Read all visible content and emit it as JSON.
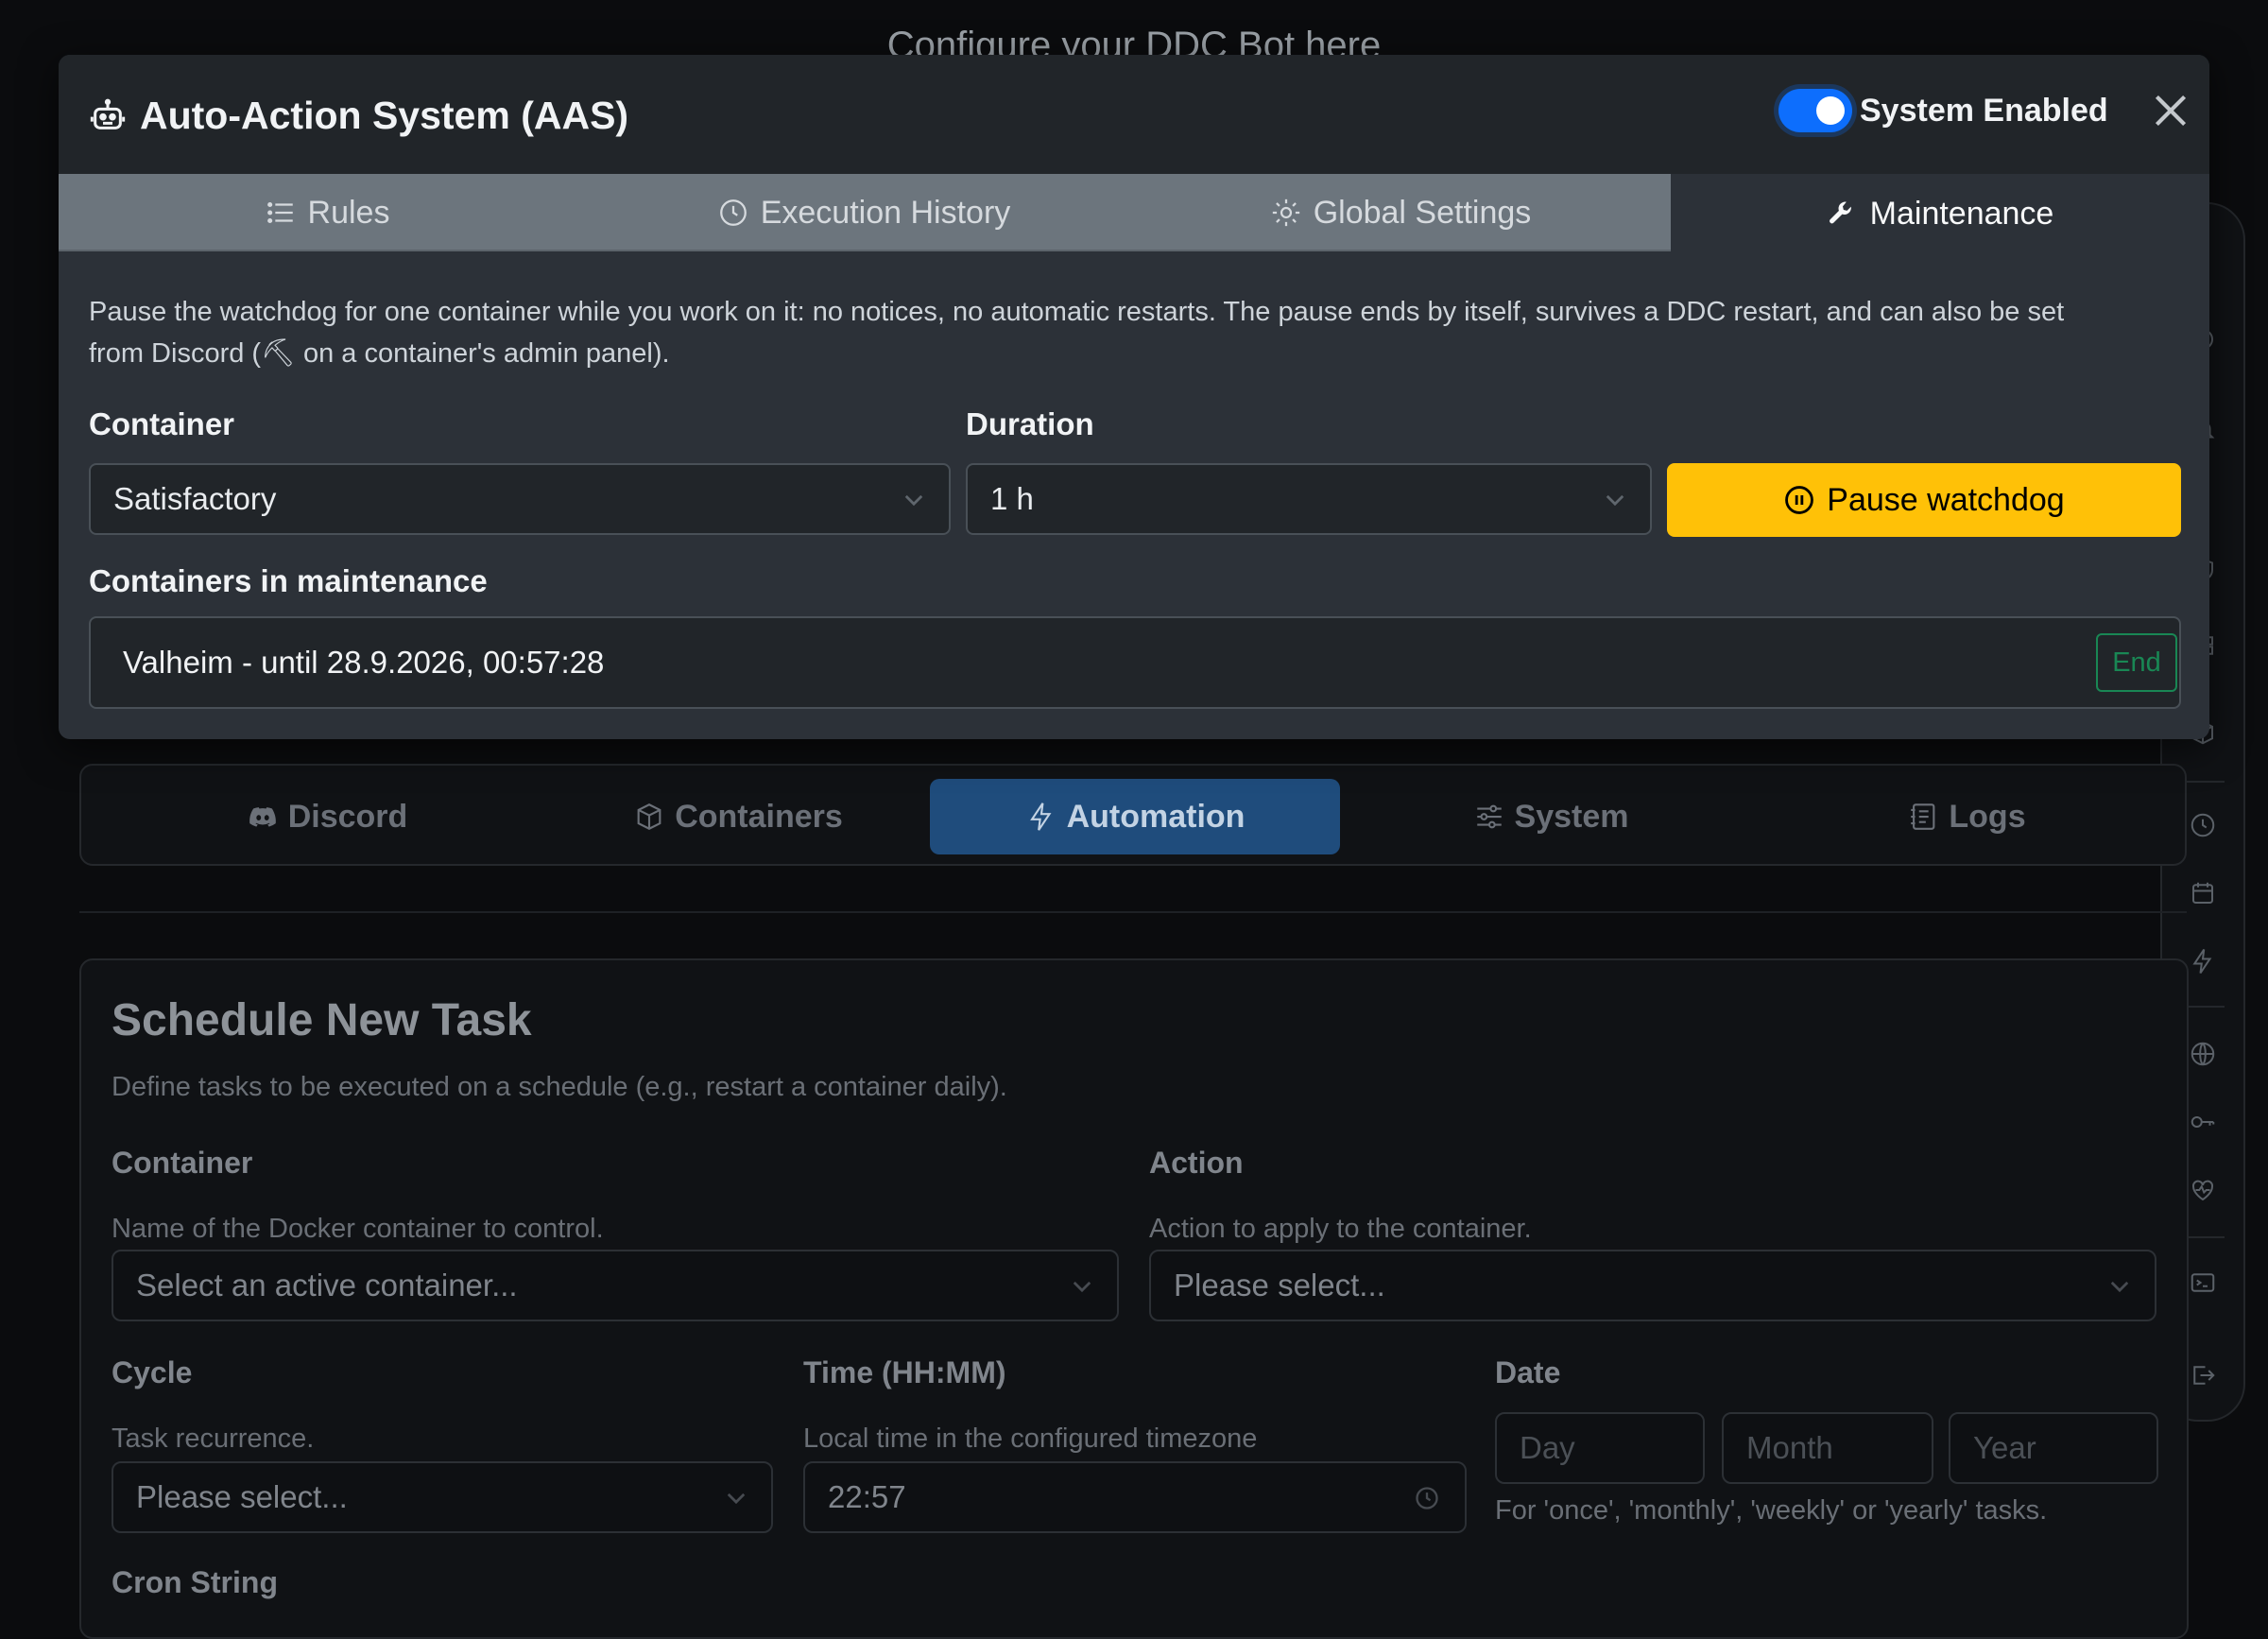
{
  "background": {
    "header_text": "Configure your DDC Bot here",
    "nav": [
      {
        "label": "Discord",
        "icon": "discord-icon"
      },
      {
        "label": "Containers",
        "icon": "box-icon"
      },
      {
        "label": "Automation",
        "icon": "lightning-icon",
        "active": true
      },
      {
        "label": "System",
        "icon": "sliders-icon"
      },
      {
        "label": "Logs",
        "icon": "journal-icon"
      }
    ],
    "schedule": {
      "title": "Schedule New Task",
      "description": "Define tasks to be executed on a schedule (e.g., restart a container daily).",
      "container_label": "Container",
      "container_help": "Name of the Docker container to control.",
      "container_placeholder": "Select an active container...",
      "action_label": "Action",
      "action_help": "Action to apply to the container.",
      "action_placeholder": "Please select...",
      "cycle_label": "Cycle",
      "cycle_help": "Task recurrence.",
      "cycle_placeholder": "Please select...",
      "time_label": "Time (HH:MM)",
      "time_help": "Local time in the configured timezone",
      "time_value": "22:57",
      "date_label": "Date",
      "date_day_placeholder": "Day",
      "date_month_placeholder": "Month",
      "date_year_placeholder": "Year",
      "date_help": "For 'once', 'monthly', 'weekly' or 'yearly' tasks.",
      "cron_label": "Cron String"
    }
  },
  "modal": {
    "title": "Auto-Action System (AAS)",
    "title_icon": "robot-icon",
    "system_toggle_label": "System Enabled",
    "system_enabled": true,
    "tabs": [
      {
        "label": "Rules",
        "icon": "list-icon"
      },
      {
        "label": "Execution History",
        "icon": "clock-icon"
      },
      {
        "label": "Global Settings",
        "icon": "gear-icon"
      },
      {
        "label": "Maintenance",
        "icon": "wrench-icon",
        "active": true
      }
    ],
    "maintenance": {
      "intro_line1": "Pause the watchdog for one container while you work on it: no notices, no automatic restarts. The pause ends by itself, survives a DDC restart, and can also be set",
      "intro_line2": "from Discord (⛏ on a container's admin panel).",
      "container_label": "Container",
      "container_value": "Satisfactory",
      "duration_label": "Duration",
      "duration_value": "1 h",
      "pause_button": "Pause watchdog",
      "list_label": "Containers in maintenance",
      "entries": [
        {
          "text": "Valheim - until 28.9.2026, 00:57:28",
          "end_label": "End"
        }
      ]
    }
  },
  "colors": {
    "modal_bg": "#2c3138",
    "tabbar_bg": "#6c757d",
    "accent_blue": "#0d6efd",
    "warning_yellow": "#ffc107",
    "success_green": "#198754"
  }
}
